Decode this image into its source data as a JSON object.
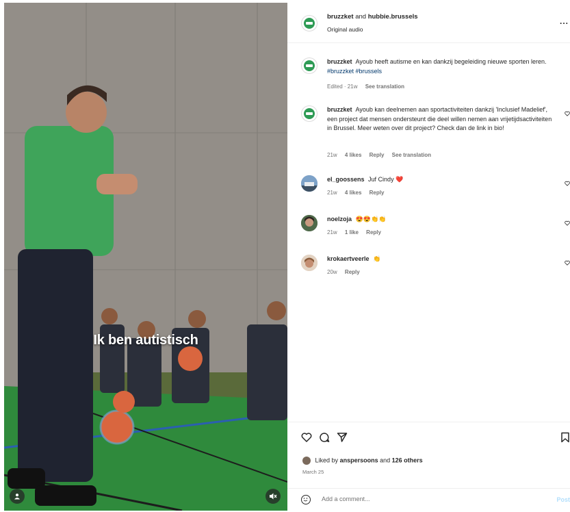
{
  "media": {
    "overlay_text": "Ik ben autistisch"
  },
  "header": {
    "author": "bruzzket",
    "and_text": "and",
    "collaborator": "hubbie.brussels",
    "audio": "Original audio",
    "more": "..."
  },
  "comments": [
    {
      "user": "bruzzket",
      "text": "Ayoub heeft autisme en kan dankzij begeleiding nieuwe sporten leren.",
      "hashtags": "#bruzzket #brussels",
      "meta": [
        "Edited · 21w",
        "See translation"
      ]
    },
    {
      "user": "bruzzket",
      "text": "Ayoub kan deelnemen aan sportactiviteiten dankzij 'Inclusief Madelief', een project dat mensen ondersteunt die deel willen nemen aan vrijetijdsactiviteiten in Brussel. Meer weten over dit project? Check dan de link in bio!",
      "meta": [
        "21w",
        "4 likes",
        "Reply",
        "See translation"
      ]
    },
    {
      "user": "el_goossens",
      "text": "Juf Cindy ❤️",
      "meta": [
        "21w",
        "4 likes",
        "Reply"
      ]
    },
    {
      "user": "noelzoja",
      "text": "😍😍👏👏",
      "meta": [
        "21w",
        "1 like",
        "Reply"
      ]
    },
    {
      "user": "krokaertveerle",
      "text": "👏",
      "meta": [
        "20w",
        "Reply"
      ]
    }
  ],
  "actions": {
    "liked_prefix": "Liked by",
    "liked_user": "anspersoons",
    "liked_and": "and",
    "liked_others": "126 others",
    "date": "March 25"
  },
  "add_comment": {
    "placeholder": "Add a comment...",
    "post_label": "Post"
  },
  "colors": {
    "brand_green": "#2e9b55",
    "link": "#00376b",
    "muted": "#737373",
    "post_disabled": "#b2dffc",
    "heart": "#ed4956"
  }
}
